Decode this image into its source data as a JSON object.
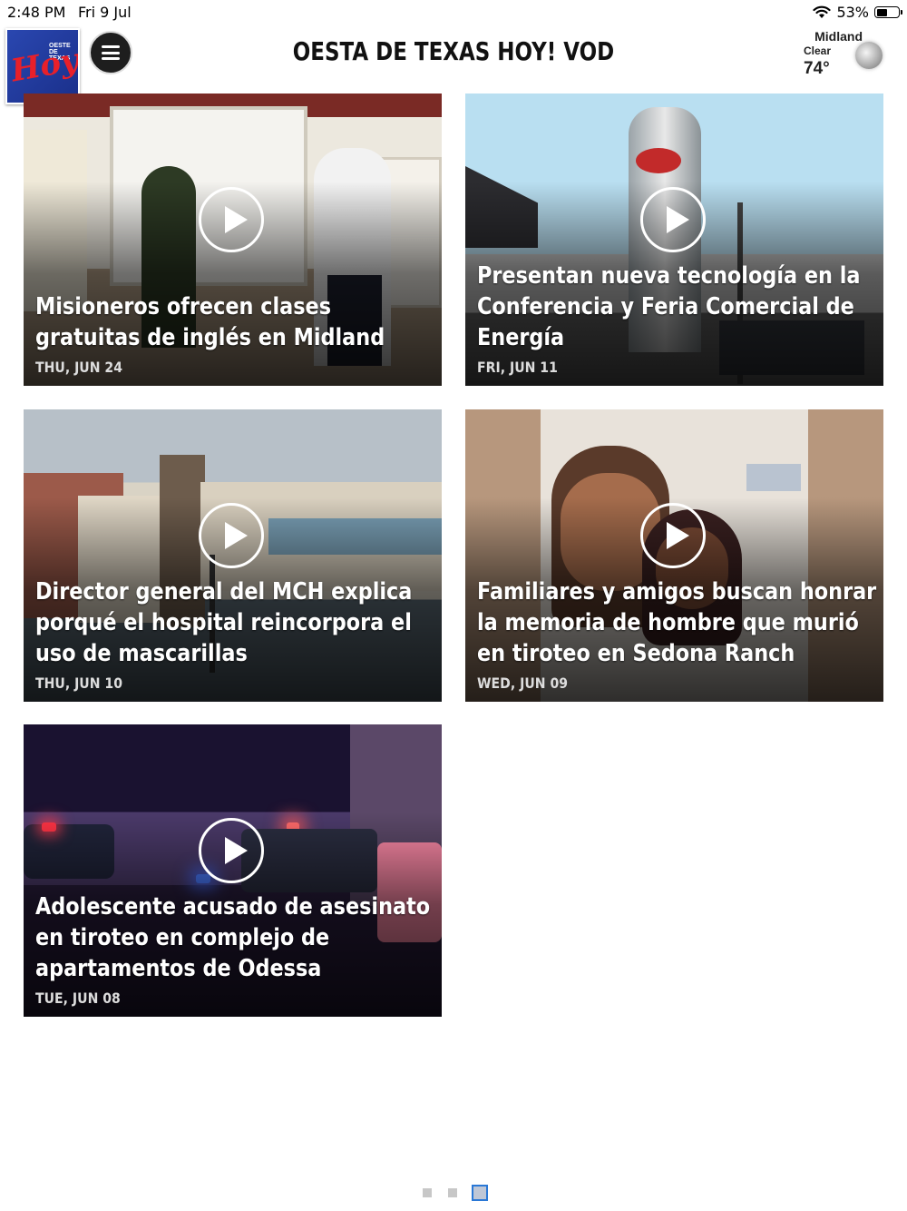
{
  "status_bar": {
    "time": "2:48 PM",
    "date": "Fri 9 Jul",
    "battery": "53%",
    "battery_level": 0.53
  },
  "header": {
    "title": "OESTA DE TEXAS HOY! VOD",
    "logo": {
      "line1": "OESTE DE",
      "line2": "TEXAS",
      "main": "Hoy!"
    },
    "weather": {
      "city": "Midland",
      "condition": "Clear",
      "temperature": "74°",
      "icon": "moon-icon"
    }
  },
  "videos": [
    {
      "title": "Misioneros ofrecen clases gratuitas de inglés en Midland",
      "date": "THU, JUN 24"
    },
    {
      "title": "Presentan nueva tecnología en la Conferencia y Feria Comercial de Energía",
      "date": "FRI, JUN 11"
    },
    {
      "title": "Director general del MCH explica porqué el hospital reincorpora el uso de mascarillas",
      "date": "THU, JUN 10"
    },
    {
      "title": "Familiares y amigos buscan honrar la memoria de hombre que murió en tiroteo en Sedona Ranch",
      "date": "WED, JUN 09"
    },
    {
      "title": "Adolescente acusado de asesinato en tiroteo en complejo de apartamentos de Odessa",
      "date": "TUE, JUN 08"
    }
  ],
  "pager": {
    "pages": 3,
    "current": 3
  },
  "colors": {
    "accent": "#2a78d6",
    "logo_blue": "#2a47b0",
    "logo_red": "#e8202a"
  }
}
